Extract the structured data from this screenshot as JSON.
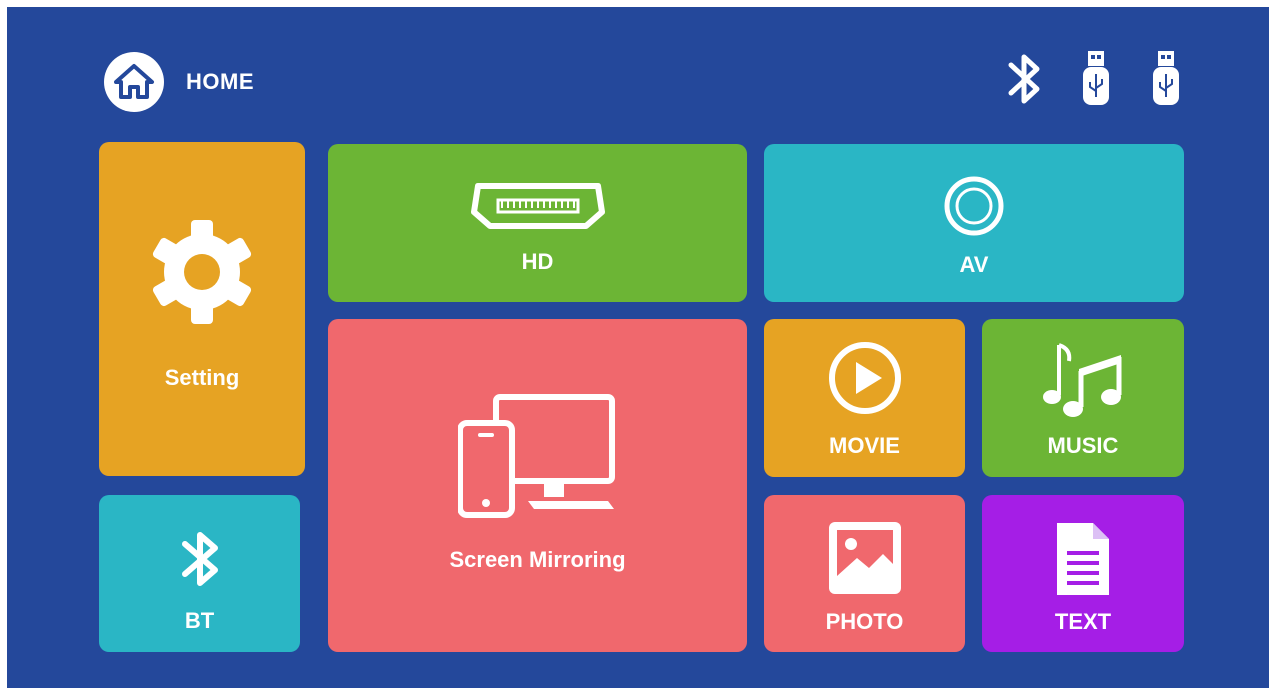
{
  "header": {
    "title": "HOME"
  },
  "status_bar": {
    "icons": [
      "bluetooth-icon",
      "usb-drive-icon",
      "usb-drive-icon"
    ]
  },
  "tiles": {
    "setting": {
      "label": "Setting",
      "icon": "gear-icon",
      "color": "#e6a323"
    },
    "hd": {
      "label": "HD",
      "icon": "hdmi-port-icon",
      "color": "#6cb535"
    },
    "av": {
      "label": "AV",
      "icon": "av-jack-icon",
      "color": "#2ab6c5"
    },
    "mirroring": {
      "label": "Screen Mirroring",
      "icon": "screen-mirror-icon",
      "color": "#f0686d"
    },
    "movie": {
      "label": "MOVIE",
      "icon": "play-circle-icon",
      "color": "#e6a323"
    },
    "music": {
      "label": "MUSIC",
      "icon": "music-notes-icon",
      "color": "#6cb535"
    },
    "bt": {
      "label": "BT",
      "icon": "bluetooth-icon",
      "color": "#2ab6c5"
    },
    "photo": {
      "label": "PHOTO",
      "icon": "picture-icon",
      "color": "#f0686d"
    },
    "text": {
      "label": "TEXT",
      "icon": "document-icon",
      "color": "#a51ee6"
    }
  },
  "colors": {
    "background": "#24489b",
    "foreground": "#ffffff"
  }
}
